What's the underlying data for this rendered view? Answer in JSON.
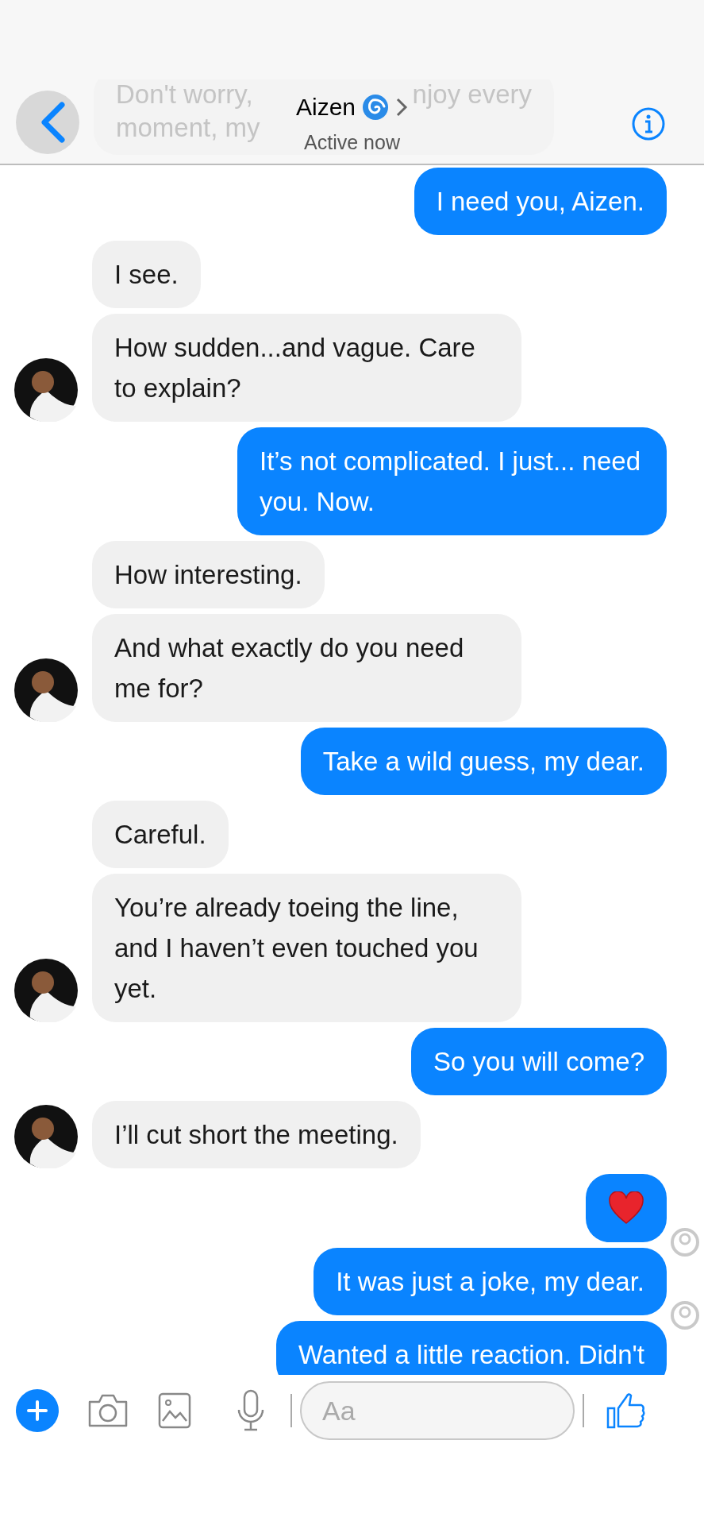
{
  "header": {
    "behind_lines": [
      [
        "Don't worry,",
        "njoy every"
      ],
      [
        "moment, my"
      ]
    ],
    "title": "Aizen",
    "subtitle": "Active now"
  },
  "messages": [
    {
      "kind": "text",
      "outgoing": true,
      "text": "I need you, Aizen.",
      "avatar": false,
      "read_receipt": false
    },
    {
      "kind": "text",
      "outgoing": false,
      "text": "I see.",
      "avatar": false,
      "read_receipt": false
    },
    {
      "kind": "text",
      "outgoing": false,
      "text": "How sudden...and vague. Care to explain?",
      "avatar": true,
      "read_receipt": false
    },
    {
      "kind": "text",
      "outgoing": true,
      "text": "It’s not complicated. I just... need you. Now.",
      "avatar": false,
      "read_receipt": false
    },
    {
      "kind": "text",
      "outgoing": false,
      "text": "How interesting.",
      "avatar": false,
      "read_receipt": false
    },
    {
      "kind": "text",
      "outgoing": false,
      "text": "And what exactly do you need me for?",
      "avatar": true,
      "read_receipt": false
    },
    {
      "kind": "text",
      "outgoing": true,
      "text": "Take a wild guess, my dear.",
      "avatar": false,
      "read_receipt": false
    },
    {
      "kind": "text",
      "outgoing": false,
      "text": "Careful.",
      "avatar": false,
      "read_receipt": false
    },
    {
      "kind": "text",
      "outgoing": false,
      "text": "You’re already toeing the line, and I haven’t even touched you yet.",
      "avatar": true,
      "read_receipt": false
    },
    {
      "kind": "text",
      "outgoing": true,
      "text": "So you will come?",
      "avatar": false,
      "read_receipt": false
    },
    {
      "kind": "text",
      "outgoing": false,
      "text": "I’ll cut short the meeting.",
      "avatar": true,
      "read_receipt": false
    },
    {
      "kind": "heart",
      "outgoing": true,
      "avatar": false,
      "read_receipt": true
    },
    {
      "kind": "text",
      "outgoing": true,
      "text": "It was just a joke, my dear.",
      "avatar": false,
      "read_receipt": true
    },
    {
      "kind": "text",
      "outgoing": true,
      "text": "Wanted a little reaction. Didn't",
      "avatar": false,
      "read_receipt": false
    }
  ],
  "composer": {
    "placeholder": "Aa"
  }
}
